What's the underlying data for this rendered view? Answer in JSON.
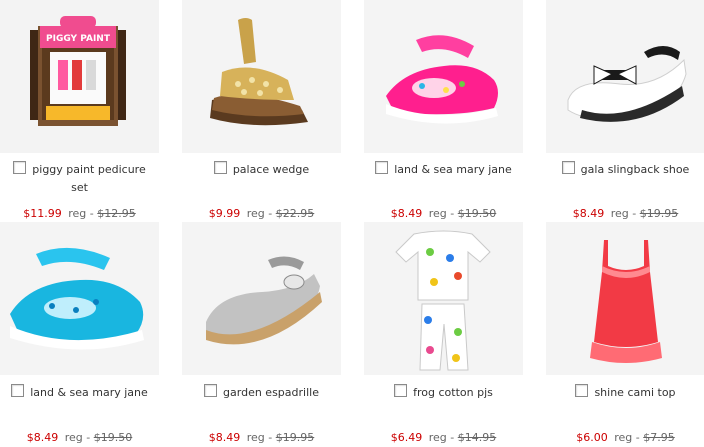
{
  "products": [
    {
      "name_l1": "piggy paint pedicure",
      "name_l2": "set",
      "sale": "$11.99",
      "reg": "reg -",
      "was": "$12.95",
      "image": "piggy-paint-kit",
      "colors": {
        "accent": "#e8327a"
      }
    },
    {
      "name_l1": "palace wedge",
      "name_l2": "",
      "sale": "$9.99",
      "reg": "reg -",
      "was": "$22.95",
      "image": "gold-sandal",
      "colors": {
        "accent": "#c9a24a"
      }
    },
    {
      "name_l1": "land & sea mary jane",
      "name_l2": "",
      "sale": "$8.49",
      "reg": "reg -",
      "was": "$19.50",
      "image": "pink-mary-jane",
      "colors": {
        "accent": "#ff1f8e"
      }
    },
    {
      "name_l1": "gala slingback shoe",
      "name_l2": "",
      "sale": "$8.49",
      "reg": "reg -",
      "was": "$19.95",
      "image": "white-slingback",
      "colors": {
        "accent": "#ffffff"
      }
    },
    {
      "name_l1": "land & sea mary jane",
      "name_l2": "",
      "sale": "$8.49",
      "reg": "reg -",
      "was": "$19.50",
      "image": "blue-mary-jane",
      "colors": {
        "accent": "#19b6e0"
      }
    },
    {
      "name_l1": "garden espadrille",
      "name_l2": "",
      "sale": "$8.49",
      "reg": "reg -",
      "was": "$19.95",
      "image": "silver-espadrille",
      "colors": {
        "accent": "#bdbdbd"
      }
    },
    {
      "name_l1": "frog cotton pjs",
      "name_l2": "",
      "sale": "$6.49",
      "reg": "reg -",
      "was": "$14.95",
      "image": "frog-pajamas",
      "colors": {
        "accent": "#f2f2f2"
      }
    },
    {
      "name_l1": "shine cami top",
      "name_l2": "",
      "sale": "$6.00",
      "reg": "reg -",
      "was": "$7.95",
      "image": "red-cami-top",
      "colors": {
        "accent": "#f23a45"
      }
    }
  ],
  "colors": {
    "sale_price": "#cc0000",
    "text": "#333333",
    "muted": "#666666"
  }
}
